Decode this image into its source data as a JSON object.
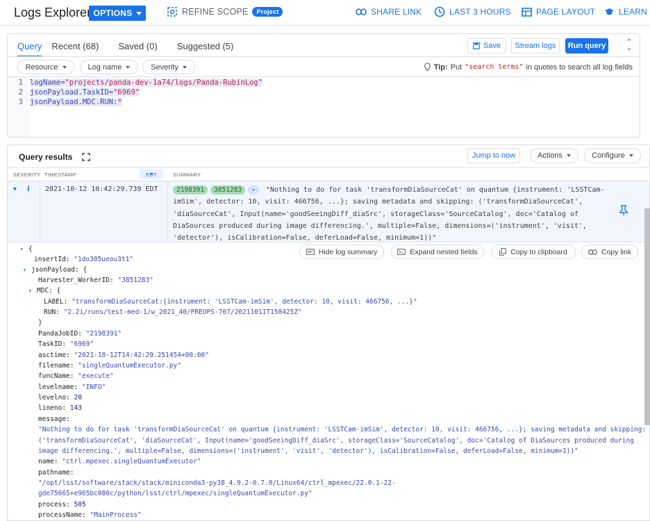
{
  "topbar": {
    "title": "Logs Explorer",
    "options": "OPTIONS",
    "refine_scope": "REFINE SCOPE",
    "project_badge": "Project",
    "share_link": "SHARE LINK",
    "last_hours": "LAST 3 HOURS",
    "page_layout": "PAGE LAYOUT",
    "learn": "LEARN"
  },
  "query": {
    "tabs": [
      "Query",
      "Recent (68)",
      "Saved (0)",
      "Suggested (5)"
    ],
    "save": "Save",
    "stream_logs": "Stream logs",
    "run_query": "Run query",
    "filters": [
      "Resource",
      "Log name",
      "Severity"
    ],
    "tip_label": "Tip:",
    "tip_put": "Put",
    "tip_code": "\"search terms\"",
    "tip_rest": "in quotes to search all log fields",
    "lines": [
      {
        "n": "1",
        "key": "logName=",
        "val": "\"projects/panda-dev-1a74/logs/Panda-RubinLog\""
      },
      {
        "n": "2",
        "key": "jsonPayload.TaskID=",
        "val": "\"6969\""
      },
      {
        "n": "3",
        "key": "jsonPayload.MDC.RUN:",
        "val": "*"
      }
    ]
  },
  "results": {
    "title": "Query results",
    "jump_to_now": "Jump to now",
    "actions": "Actions",
    "configure": "Configure",
    "col_severity": "SEVERITY",
    "col_timestamp": "TIMESTAMP",
    "col_tz": "EDT",
    "col_summary": "SUMMARY",
    "row": {
      "severity": "i",
      "timestamp": "2021-10-12 10:42:29.739 EDT",
      "pill1": "2198391",
      "pill2": "3851283",
      "pill3": "-",
      "summary": "\"Nothing to do for task 'transformDiaSourceCat' on quantum {instrument: 'LSSTCam-imSim', detector: 10, visit: 466756, ...}; saving metadata and skipping: ('transformDiaSourceCat', 'diaSourceCat', Input(name='goodSeeingDiff_diaSrc', storageClass='SourceCatalog', doc='Catalog of DiaSources produced during image differencing.', multiple=False, dimensions=('instrument', 'visit', 'detector'), isCalibration=False, deferLoad=False, minimum=1))\""
    },
    "detail_buttons": [
      "Hide log summary",
      "Expand nested fields",
      "Copy to clipboard",
      "Copy link"
    ],
    "detail": {
      "open_brace": "{",
      "insertId_k": "insertId:",
      "insertId_v": "\"1do305ueou3t1\"",
      "jsonPayload_k": "jsonPayload: {",
      "harvester_k": "Harvester_WorkerID:",
      "harvester_v": "\"3851283\"",
      "mdc_k": "MDC: {",
      "label_k": "LABEL:",
      "label_v": "\"transformDiaSourceCat:{instrument: 'LSSTCam-imSim', detector: 10, visit: 466756, ...}\"",
      "run_k": "RUN:",
      "run_v": "\"2.2i/runs/test-med-1/w_2021_40/PREOPS-707/20211011T150425Z\"",
      "close_mdc": "}",
      "pandajob_k": "PandaJobID:",
      "pandajob_v": "\"2198391\"",
      "taskid_k": "TaskID:",
      "taskid_v": "\"6969\"",
      "asctime_k": "asctime:",
      "asctime_v": "\"2021-10-12T14:42:29.251454+00:00\"",
      "filename_k": "filename:",
      "filename_v": "\"singleQuantumExecutor.py\"",
      "funcname_k": "funcName:",
      "funcname_v": "\"execute\"",
      "levelname_k": "levelname:",
      "levelname_v": "\"INFO\"",
      "levelno_k": "levelno:",
      "levelno_v": "20",
      "lineno_k": "lineno:",
      "lineno_v": "143",
      "message_k": "message:",
      "message_1": "\"Nothing to do for task 'transformDiaSourceCat' on quantum {instrument: 'LSSTCam-imSim', detector: 10, visit: 466756, ...}; saving metadata and skipping:",
      "message_2": "('transformDiaSourceCat', 'diaSourceCat', Input(name='goodSeeingDiff_diaSrc', storageClass='SourceCatalog', doc='Catalog of DiaSources produced during",
      "message_3": "image differencing.', multiple=False, dimensions=('instrument', 'visit', 'detector'), isCalibration=False, deferLoad=False, minimum=1))\"",
      "name_k": "name:",
      "name_v": "\"ctrl.mpexec.singleQuantumExecutor\"",
      "pathname_k": "pathname:",
      "pathname_1": "\"/opt/lsst/software/stack/stack/miniconda3-py38_4.9.2-0.7.0/Linux64/ctrl_mpexec/22.0.1-22-",
      "pathname_2": "gde75665+e965bc080c/python/lsst/ctrl/mpexec/singleQuantumExecutor.py\"",
      "process_k": "process:",
      "process_v": "505",
      "processname_k": "processName:",
      "processname_v": "\"MainProcess\""
    }
  },
  "colors": {
    "accent": "#1a73e8",
    "pill_green": "#a8dab5",
    "row_bg": "#f1f6fe"
  }
}
